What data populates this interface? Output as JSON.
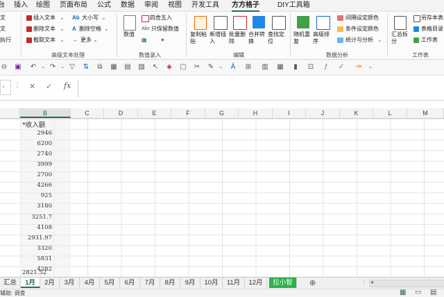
{
  "menu": {
    "items": [
      "台",
      "插入",
      "绘图",
      "页面布局",
      "公式",
      "数据",
      "审阅",
      "视图",
      "开发工具",
      "方方格子",
      "DIY工具箱"
    ],
    "active_index": 9
  },
  "ribbon": {
    "left_partial": [
      "文",
      "文",
      "执行"
    ],
    "text_group": {
      "insert_text": "插入文本",
      "delete_text": "删除文本",
      "extract_text": "截取文本",
      "case": "大小写",
      "delete_space": "删除空格",
      "more": "更多",
      "label": "高级文本处理"
    },
    "number_group": {
      "numeric": "数值",
      "round": "四舍五入",
      "keep_numeric": "只保留数值",
      "label": "数值录入"
    },
    "edit_group": {
      "copy_paste": "复制粘贴",
      "add_insert": "新增插入",
      "batch_delete": "批量删除",
      "merge_convert": "合并转换",
      "find_locate": "查找定位",
      "label": "编辑"
    },
    "analysis_group": {
      "random_repeat": "随机重复",
      "advanced_sort": "高级排序",
      "interval_color": "间隔设定颜色",
      "cond_color": "条件设定颜色",
      "stats": "统计与分析",
      "label": "数据分析"
    },
    "workbook_group": {
      "summary_split": "汇总拆分",
      "save_as": "另存本表",
      "table_dir": "表格目录",
      "worksheet": "工作表",
      "label": "工作表"
    }
  },
  "formula": {
    "name_box": "",
    "fx": "fx",
    "cancel": "✕",
    "confirm": "✓",
    "value": ""
  },
  "columns": [
    "B",
    "C",
    "D",
    "E",
    "F",
    "G",
    "H",
    "I",
    "J",
    "K",
    "L",
    "M"
  ],
  "selected_column": "B",
  "cells": {
    "header": "*收入额",
    "values": [
      "2946",
      "6200",
      "2740",
      "3999",
      "2700",
      "4266",
      "925",
      "3180",
      "3251.7",
      "4108",
      "2931.97",
      "3320",
      "5831",
      "4282",
      "2821.52"
    ]
  },
  "tabs": {
    "items": [
      "汇总",
      "1月",
      "2月",
      "3月",
      "4月",
      "5月",
      "6月",
      "7月",
      "8月",
      "9月",
      "10月",
      "11月",
      "12月",
      "拉小智"
    ],
    "active_index": 1,
    "add": "⊕"
  },
  "status": {
    "text": "辅助: 调查"
  }
}
